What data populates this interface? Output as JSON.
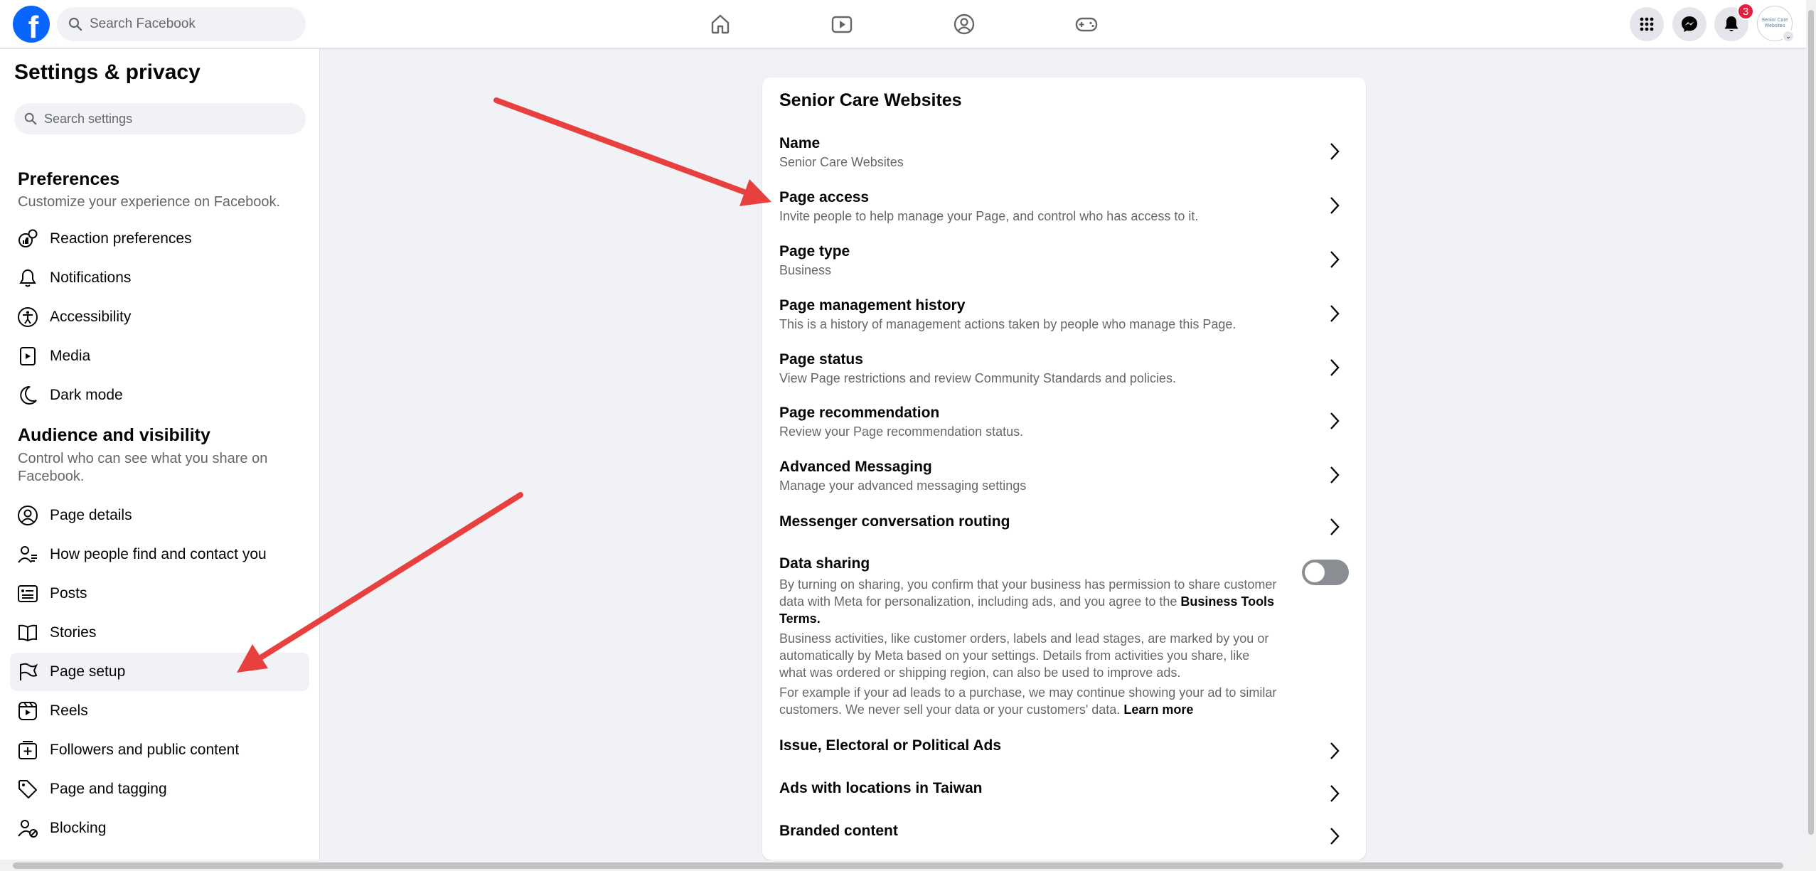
{
  "topbar": {
    "logo_letter": "f",
    "search_placeholder": "Search Facebook",
    "notifications_count": "3",
    "avatar_text": "Senior Care Websites"
  },
  "sidebar": {
    "title": "Settings & privacy",
    "search_placeholder": "Search settings",
    "preferences": {
      "title": "Preferences",
      "desc": "Customize your experience on Facebook.",
      "items": [
        {
          "label": "Reaction preferences",
          "icon": "reaction-icon"
        },
        {
          "label": "Notifications",
          "icon": "bell-icon"
        },
        {
          "label": "Accessibility",
          "icon": "accessibility-icon"
        },
        {
          "label": "Media",
          "icon": "media-icon"
        },
        {
          "label": "Dark mode",
          "icon": "moon-icon"
        }
      ]
    },
    "audience": {
      "title": "Audience and visibility",
      "desc": "Control who can see what you share on Facebook.",
      "items": [
        {
          "label": "Page details",
          "icon": "user-circle-icon"
        },
        {
          "label": "How people find and contact you",
          "icon": "user-contact-icon"
        },
        {
          "label": "Posts",
          "icon": "posts-icon"
        },
        {
          "label": "Stories",
          "icon": "book-icon"
        },
        {
          "label": "Page setup",
          "icon": "flag-icon"
        },
        {
          "label": "Reels",
          "icon": "reels-icon"
        },
        {
          "label": "Followers and public content",
          "icon": "add-box-icon"
        },
        {
          "label": "Page and tagging",
          "icon": "tag-icon"
        },
        {
          "label": "Blocking",
          "icon": "block-user-icon"
        }
      ]
    }
  },
  "main": {
    "title": "Senior Care Websites",
    "rows": [
      {
        "title": "Name",
        "subtitle": "Senior Care Websites"
      },
      {
        "title": "Page access",
        "subtitle": "Invite people to help manage your Page, and control who has access to it."
      },
      {
        "title": "Page type",
        "subtitle": "Business"
      },
      {
        "title": "Page management history",
        "subtitle": "This is a history of management actions taken by people who manage this Page."
      },
      {
        "title": "Page status",
        "subtitle": "View Page restrictions and review Community Standards and policies."
      },
      {
        "title": "Page recommendation",
        "subtitle": "Review your Page recommendation status."
      },
      {
        "title": "Advanced Messaging",
        "subtitle": "Manage your advanced messaging settings"
      },
      {
        "title": "Messenger conversation routing",
        "subtitle": ""
      }
    ],
    "data_sharing": {
      "title": "Data sharing",
      "para1": "By turning on sharing, you confirm that your business has permission to share customer data with Meta for personalization, including ads, and you agree to the",
      "para1_link": "Business Tools Terms.",
      "para2": "Business activities, like customer orders, labels and lead stages, are marked by you or automatically by Meta based on your settings. Details from activities you share, like what was ordered or shipping region, can also be used to improve ads.",
      "para3": "For example if your ad leads to a purchase, we may continue showing your ad to similar customers. We never sell your data or your customers' data.",
      "para3_link": "Learn more",
      "toggle_on": false
    },
    "bottom_rows": [
      {
        "title": "Issue, Electoral or Political Ads"
      },
      {
        "title": "Ads with locations in Taiwan"
      },
      {
        "title": "Branded content"
      }
    ]
  },
  "colors": {
    "brand": "#0866ff",
    "annotation_arrow": "#e8403f",
    "badge": "#e41e3f"
  }
}
